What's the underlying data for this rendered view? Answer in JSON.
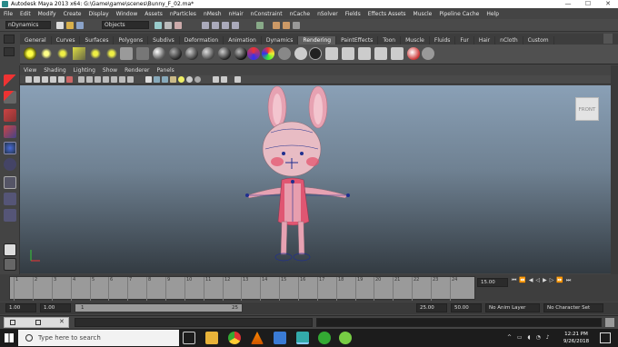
{
  "window": {
    "title": "Autodesk Maya 2013 x64: G:\\Game\\game\\scenes\\Bunny_F_02.ma*",
    "minimize": "—",
    "maximize": "☐",
    "close": "✕"
  },
  "menu": [
    "File",
    "Edit",
    "Modify",
    "Create",
    "Display",
    "Window",
    "Assets",
    "nParticles",
    "nMesh",
    "nHair",
    "nConstraint",
    "nCache",
    "nSolver",
    "Fields",
    "Effects Assets",
    "Muscle",
    "Pipeline Cache",
    "Help"
  ],
  "status_line": {
    "menu_set": "nDynamics",
    "selection_mask": "Objects"
  },
  "shelf_tabs": [
    "General",
    "Curves",
    "Surfaces",
    "Polygons",
    "Subdivs",
    "Deformation",
    "Animation",
    "Dynamics",
    "Rendering",
    "PaintEffects",
    "Toon",
    "Muscle",
    "Fluids",
    "Fur",
    "Hair",
    "nCloth",
    "Custom"
  ],
  "active_shelf_tab": "Rendering",
  "panel_menu": [
    "View",
    "Shading",
    "Lighting",
    "Show",
    "Renderer",
    "Panels"
  ],
  "view_cube": {
    "label": "FRONT"
  },
  "timeline": {
    "ticks": [
      "1",
      "2",
      "3",
      "4",
      "5",
      "6",
      "7",
      "8",
      "9",
      "10",
      "11",
      "12",
      "13",
      "14",
      "15",
      "16",
      "17",
      "18",
      "19",
      "20",
      "21",
      "22",
      "23",
      "24"
    ],
    "current_time": "15.00"
  },
  "range": {
    "start_time": "1.00",
    "playback_start": "1.00",
    "range_left": "1",
    "range_mid": "25",
    "playback_end": "25.00",
    "end_time": "50.00",
    "anim_layer": "No Anim Layer",
    "character_set": "No Character Set"
  },
  "taskbar": {
    "search_placeholder": "Type here to search",
    "time": "12:21 PM",
    "date": "9/26/2018"
  },
  "colors": {
    "viewport_top": "#8aa0b6",
    "viewport_bottom": "#333b42",
    "bunny_body": "#e7a2b2",
    "selection_blue": "#1f2f8f"
  }
}
